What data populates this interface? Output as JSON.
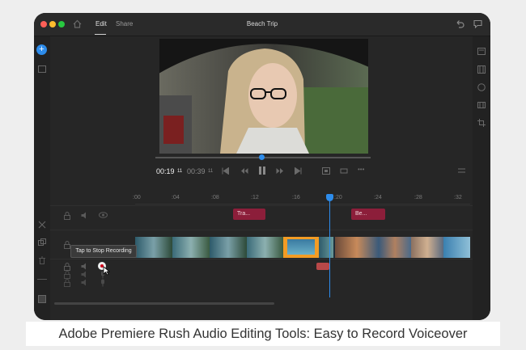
{
  "window": {
    "title": "Beach Trip",
    "tabs": {
      "edit": "Edit",
      "share": "Share"
    }
  },
  "icons": {
    "home": "home-icon",
    "undo": "undo-icon",
    "comment": "comment-icon",
    "add": "add-icon",
    "media": "media-icon",
    "scissors": "scissors-icon",
    "duplicate": "duplicate-icon",
    "trash": "trash-icon",
    "lock": "lock-icon",
    "speaker": "speaker-icon",
    "mic": "mic-icon",
    "eye": "eye-icon",
    "titles": "titles-icon",
    "transitions": "transitions-icon",
    "color": "color-icon",
    "speed": "speed-icon",
    "crop": "crop-icon",
    "fit": "fit-icon",
    "loop": "loop-icon",
    "more": "more-icon",
    "menu": "menu-icon"
  },
  "player": {
    "current_time": "00:19",
    "current_frames": "11",
    "total_time": "00:39",
    "total_frames": "11",
    "scrub_position": 0.48
  },
  "ruler": {
    "ticks": [
      ":00",
      ":04",
      ":08",
      ":12",
      ":16",
      ":20",
      ":24",
      ":28",
      ":32"
    ]
  },
  "timeline": {
    "title_clips": [
      {
        "label": "Tra..."
      },
      {
        "label": "Be..."
      }
    ],
    "playhead_time": ":19"
  },
  "tooltip": {
    "text": "Tap to Stop Recording"
  },
  "colors": {
    "accent": "#2d8ceb",
    "title_clip": "#8c1e3a",
    "audio_clip": "#b84848",
    "selected_clip": "#f39c24",
    "record": "#d0021b",
    "meter": "#2fbd3a"
  },
  "caption": "Adobe Premiere Rush Audio Editing Tools: Easy to Record Voiceover"
}
